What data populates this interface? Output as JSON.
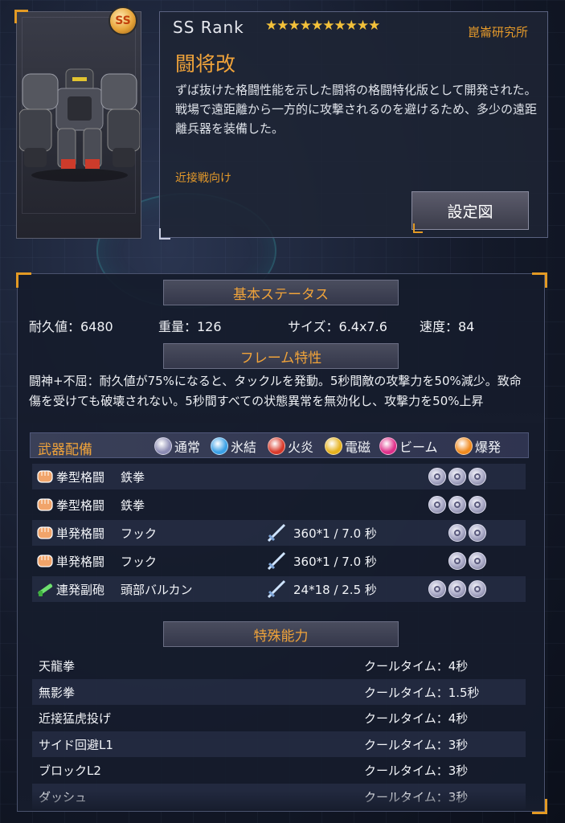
{
  "unit": {
    "rank_badge": "SS",
    "rank_label": "SS  Rank",
    "stars": "★★★★★★★★★★",
    "lab": "崑崙研究所",
    "name": "闘将改",
    "description": "ずば抜けた格闘性能を示した闘将の格闘特化版として開発された。戦場で遠距離から一方的に攻撃されるのを避けるため、多少の遠距離兵器を装備した。",
    "role": "近接戦向け",
    "settei_button": "設定図"
  },
  "basic_status": {
    "header": "基本ステータス",
    "durability": "耐久値：6480",
    "weight": "重量：126",
    "size": "サイズ：6.4x7.6",
    "speed": "速度：84"
  },
  "frame_trait": {
    "header": "フレーム特性",
    "text": "闘神+不屈：耐久値が75%になると、タックルを発動。5秒間敵の攻撃力を50%減少。致命傷を受けても破壊されない。5秒間すべての状態異常を無効化し、攻撃力を50%上昇"
  },
  "weapons": {
    "header": "武器配備",
    "legend": [
      {
        "label": "通常",
        "color": "#8c8cb4",
        "icon": "normal-icon"
      },
      {
        "label": "氷結",
        "color": "#3aa0e6",
        "icon": "ice-icon"
      },
      {
        "label": "火炎",
        "color": "#d93a2a",
        "icon": "fire-icon"
      },
      {
        "label": "電磁",
        "color": "#e6b21e",
        "icon": "electric-icon"
      },
      {
        "label": "ビーム",
        "color": "#e0308a",
        "icon": "beam-icon"
      },
      {
        "label": "爆発",
        "color": "#f08a1e",
        "icon": "explosion-icon"
      }
    ],
    "rows": [
      {
        "type": "拳型格闘",
        "name": "鉄拳",
        "stat": "",
        "slots": 3,
        "icon": "fist-icon"
      },
      {
        "type": "拳型格闘",
        "name": "鉄拳",
        "stat": "",
        "slots": 3,
        "icon": "fist-icon"
      },
      {
        "type": "単発格闘",
        "name": "フック",
        "stat": "360*1 / 7.0 秒",
        "slots": 2,
        "icon": "fist-icon"
      },
      {
        "type": "単発格闘",
        "name": "フック",
        "stat": "360*1 / 7.0 秒",
        "slots": 2,
        "icon": "fist-icon"
      },
      {
        "type": "連発副砲",
        "name": "頭部バルカン",
        "stat": "24*18 / 2.5 秒",
        "slots": 3,
        "icon": "gun-icon"
      }
    ]
  },
  "special": {
    "header": "特殊能力",
    "rows": [
      {
        "name": "天龍拳",
        "cooldown": "クールタイム：4秒"
      },
      {
        "name": "無影拳",
        "cooldown": "クールタイム：1.5秒"
      },
      {
        "name": "近接猛虎投げ",
        "cooldown": "クールタイム：4秒"
      },
      {
        "name": "サイド回避L1",
        "cooldown": "クールタイム：3秒"
      },
      {
        "name": "ブロックL2",
        "cooldown": "クールタイム：3秒"
      },
      {
        "name": "ダッシュ",
        "cooldown": "クールタイム：3秒"
      }
    ]
  }
}
